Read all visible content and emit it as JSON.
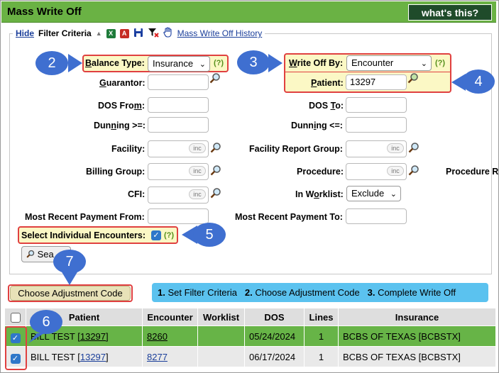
{
  "header": {
    "title": "Mass Write Off",
    "whats_this": "what's this?"
  },
  "toolbar": {
    "hide": "Hide",
    "filter_criteria": "Filter Criteria",
    "history_link": "Mass Write Off History",
    "icons": [
      "collapse-triangle-icon",
      "excel-icon",
      "pdf-icon",
      "save-icon",
      "clear-filter-icon",
      "hand-icon"
    ]
  },
  "filters": {
    "balance_type": {
      "label_u": "B",
      "label_rest": "alance Type:",
      "value": "Insurance",
      "help": "(?)"
    },
    "write_off_by": {
      "label_u": "W",
      "label_rest": "rite Off By:",
      "value": "Encounter",
      "help": "(?)"
    },
    "guarantor": {
      "label_u": "G",
      "label_rest": "uarantor:",
      "value": ""
    },
    "patient": {
      "label_u": "P",
      "label_rest": "atient:",
      "value": "13297"
    },
    "dos_from": {
      "label": "DOS Fro",
      "label_u": "m",
      "label_end": ":",
      "value": ""
    },
    "dos_to": {
      "label": "DOS ",
      "label_u": "T",
      "label_end": "o:",
      "value": ""
    },
    "dunning_ge": {
      "label": "Dun",
      "label_u": "n",
      "label_end": "ing >=:",
      "value": ""
    },
    "dunning_le": {
      "label": "Dunn",
      "label_u": "i",
      "label_end": "ng <=:",
      "value": ""
    },
    "facility": {
      "label": "Facility:",
      "inc": "inc"
    },
    "facility_report_group": {
      "label": "Facility Report Group:",
      "inc": "inc"
    },
    "billing_group": {
      "label": "Billing Group:",
      "inc": "inc"
    },
    "procedure": {
      "label": "Procedure:",
      "inc": "inc"
    },
    "procedure_r": {
      "label": "Procedure R"
    },
    "cfi": {
      "label": "CFI:",
      "inc": "inc"
    },
    "in_worklist": {
      "label": "In W",
      "label_u": "o",
      "label_end": "rklist:",
      "value": "Exclude"
    },
    "most_recent_payment_from": {
      "label": "Most Recent Payment From:",
      "value": ""
    },
    "most_recent_payment_to": {
      "label": "Most Recent Payment To:",
      "value": ""
    },
    "select_individual": {
      "label": "Select Individual Encounters:",
      "checked": true,
      "help": "(?)"
    },
    "search_button": "Sea"
  },
  "callouts": [
    "2",
    "3",
    "4",
    "5",
    "6",
    "7"
  ],
  "adjustment_button": "Choose Adjustment Code",
  "steps": [
    {
      "num": "1.",
      "text": "Set Filter Criteria"
    },
    {
      "num": "2.",
      "text": "Choose Adjustment Code"
    },
    {
      "num": "3.",
      "text": "Complete Write Off"
    }
  ],
  "table": {
    "columns": [
      "",
      "Patient",
      "Encounter",
      "Worklist",
      "DOS",
      "Lines",
      "Insurance"
    ],
    "rows": [
      {
        "checked": true,
        "patient_name": "BILL TEST [",
        "patient_id": "13297",
        "patient_end": "]",
        "encounter": "8260",
        "worklist": "",
        "dos": "05/24/2024",
        "lines": "1",
        "insurance": "BCBS OF TEXAS [BCBSTX]"
      },
      {
        "checked": true,
        "patient_name": "BILL TEST [",
        "patient_id": "13297",
        "patient_end": "]",
        "encounter": "8277",
        "worklist": "",
        "dos": "06/17/2024",
        "lines": "1",
        "insurance": "BCBS OF TEXAS [BCBSTX]"
      }
    ]
  },
  "colors": {
    "header_green": "#6ab244",
    "highlight_row": "#67b447",
    "callout_blue": "#3f6fd0",
    "annotation_red": "#e04040",
    "steps_bg": "#5bc2ef"
  }
}
